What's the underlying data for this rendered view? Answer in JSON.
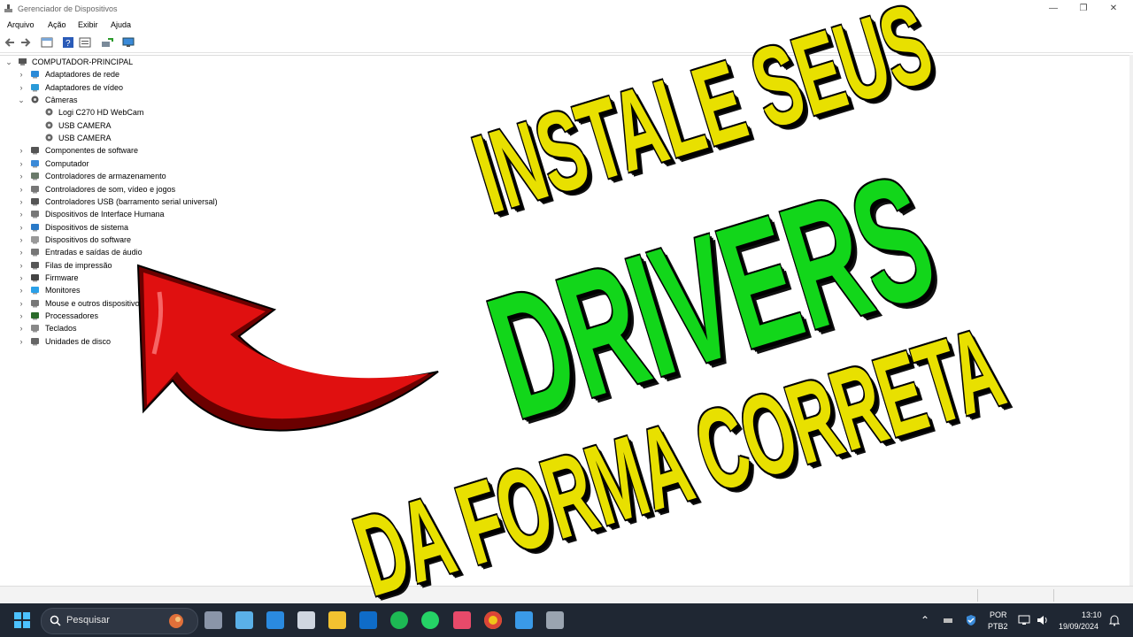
{
  "window": {
    "title": "Gerenciador de Dispositivos",
    "minimize_glyph": "—",
    "maximize_glyph": "❐",
    "close_glyph": "✕"
  },
  "menu": [
    "Arquivo",
    "Ação",
    "Exibir",
    "Ajuda"
  ],
  "toolbar_icons": [
    "back-icon",
    "forward-icon",
    "properties-icon",
    "help-icon",
    "details-icon",
    "scan-hardware-icon",
    "monitor-icon"
  ],
  "tree": {
    "root": "COMPUTADOR-PRINCIPAL",
    "nodes": [
      {
        "label": "Adaptadores de rede",
        "icon": "network-adapter-icon",
        "expanded": false
      },
      {
        "label": "Adaptadores de vídeo",
        "icon": "display-adapter-icon",
        "expanded": false
      },
      {
        "label": "Câmeras",
        "icon": "camera-icon",
        "expanded": true
      },
      {
        "label": "Logi C270 HD WebCam",
        "icon": "webcam-icon",
        "child": true
      },
      {
        "label": "USB CAMERA",
        "icon": "webcam-icon",
        "child": true
      },
      {
        "label": "USB CAMERA",
        "icon": "webcam-icon",
        "child": true
      },
      {
        "label": "Componentes de software",
        "icon": "software-component-icon",
        "expanded": false
      },
      {
        "label": "Computador",
        "icon": "computer-icon",
        "expanded": false
      },
      {
        "label": "Controladores de armazenamento",
        "icon": "storage-controller-icon",
        "expanded": false
      },
      {
        "label": "Controladores de som, vídeo e jogos",
        "icon": "speaker-icon",
        "expanded": false
      },
      {
        "label": "Controladores USB (barramento serial universal)",
        "icon": "usb-icon",
        "expanded": false
      },
      {
        "label": "Dispositivos de Interface Humana",
        "icon": "hid-icon",
        "expanded": false
      },
      {
        "label": "Dispositivos de sistema",
        "icon": "system-device-icon",
        "expanded": false
      },
      {
        "label": "Dispositivos do software",
        "icon": "software-device-icon",
        "expanded": false
      },
      {
        "label": "Entradas e saídas de áudio",
        "icon": "audio-io-icon",
        "expanded": false
      },
      {
        "label": "Filas de impressão",
        "icon": "printer-icon",
        "expanded": false
      },
      {
        "label": "Firmware",
        "icon": "firmware-icon",
        "expanded": false
      },
      {
        "label": "Monitores",
        "icon": "monitor-icon",
        "expanded": false
      },
      {
        "label": "Mouse e outros dispositivos",
        "icon": "mouse-icon",
        "expanded": false
      },
      {
        "label": "Processadores",
        "icon": "processor-icon",
        "expanded": false
      },
      {
        "label": "Teclados",
        "icon": "keyboard-icon",
        "expanded": false
      },
      {
        "label": "Unidades de disco",
        "icon": "disk-drive-icon",
        "expanded": false
      }
    ]
  },
  "overlay": {
    "line1": "INSTALE SEUS",
    "line2": "DRIVERS",
    "line3": "DA FORMA CORRETA",
    "colors": {
      "yellow": "#e8e000",
      "green": "#12d61a",
      "arrow_red": "#e01010",
      "arrow_dark": "#6b0000"
    }
  },
  "taskbar": {
    "search_placeholder": "Pesquisar",
    "apps": [
      "start-icon",
      "task-view-icon",
      "remote-desktop-icon",
      "app-blue-icon",
      "camera-app-icon",
      "file-explorer-icon",
      "outlook-icon",
      "spotify-icon",
      "whatsapp-icon",
      "snipping-tool-icon",
      "chrome-icon",
      "paint-icon",
      "device-manager-icon"
    ],
    "lang_top": "POR",
    "lang_bottom": "PTB2",
    "time": "13:10",
    "date": "19/09/2024"
  }
}
